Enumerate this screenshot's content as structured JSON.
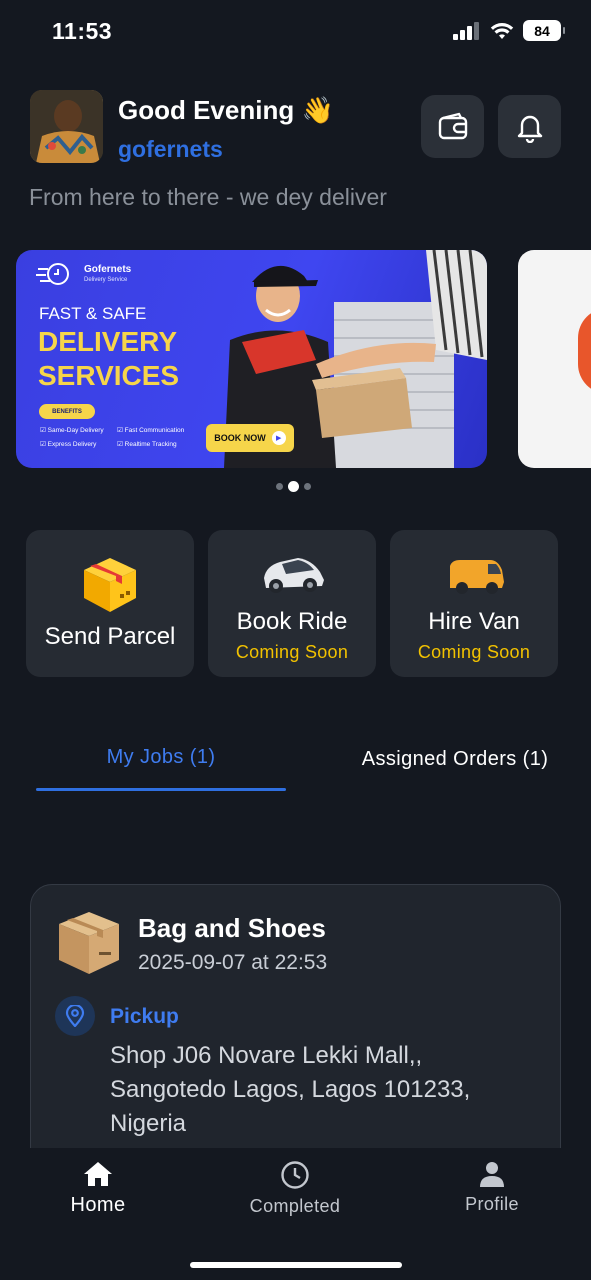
{
  "status_bar": {
    "time": "11:53",
    "battery": "84"
  },
  "header": {
    "greeting": "Good Evening 👋",
    "username": "gofernets",
    "tagline": "From here to there - we dey deliver"
  },
  "banner": {
    "brand": "Gofernets",
    "brand_sub": "Delivery Service",
    "headline_small": "FAST & SAFE",
    "headline_line1": "DELIVERY",
    "headline_line2": "SERVICES",
    "benefits_label": "BENEFITS",
    "benefits": [
      "Same-Day Delivery",
      "Fast Communication",
      "Express Delivery",
      "Realtime Tracking"
    ],
    "cta": "BOOK NOW"
  },
  "services": [
    {
      "label": "Send Parcel",
      "sub": ""
    },
    {
      "label": "Book Ride",
      "sub": "Coming Soon"
    },
    {
      "label": "Hire Van",
      "sub": "Coming Soon"
    }
  ],
  "tabs": {
    "my_jobs": "My Jobs (1)",
    "assigned": "Assigned Orders (1)"
  },
  "job": {
    "title": "Bag and Shoes",
    "date": "2025-09-07 at 22:53",
    "pickup_label": "Pickup",
    "pickup_address": "Shop J06 Novare Lekki Mall,, Sangotedo Lagos, Lagos 101233, Nigeria"
  },
  "nav": {
    "home": "Home",
    "completed": "Completed",
    "profile": "Profile"
  },
  "colors": {
    "accent": "#2f6fe0",
    "coming_soon": "#f2c200",
    "background": "#141820",
    "card": "#262b33"
  }
}
